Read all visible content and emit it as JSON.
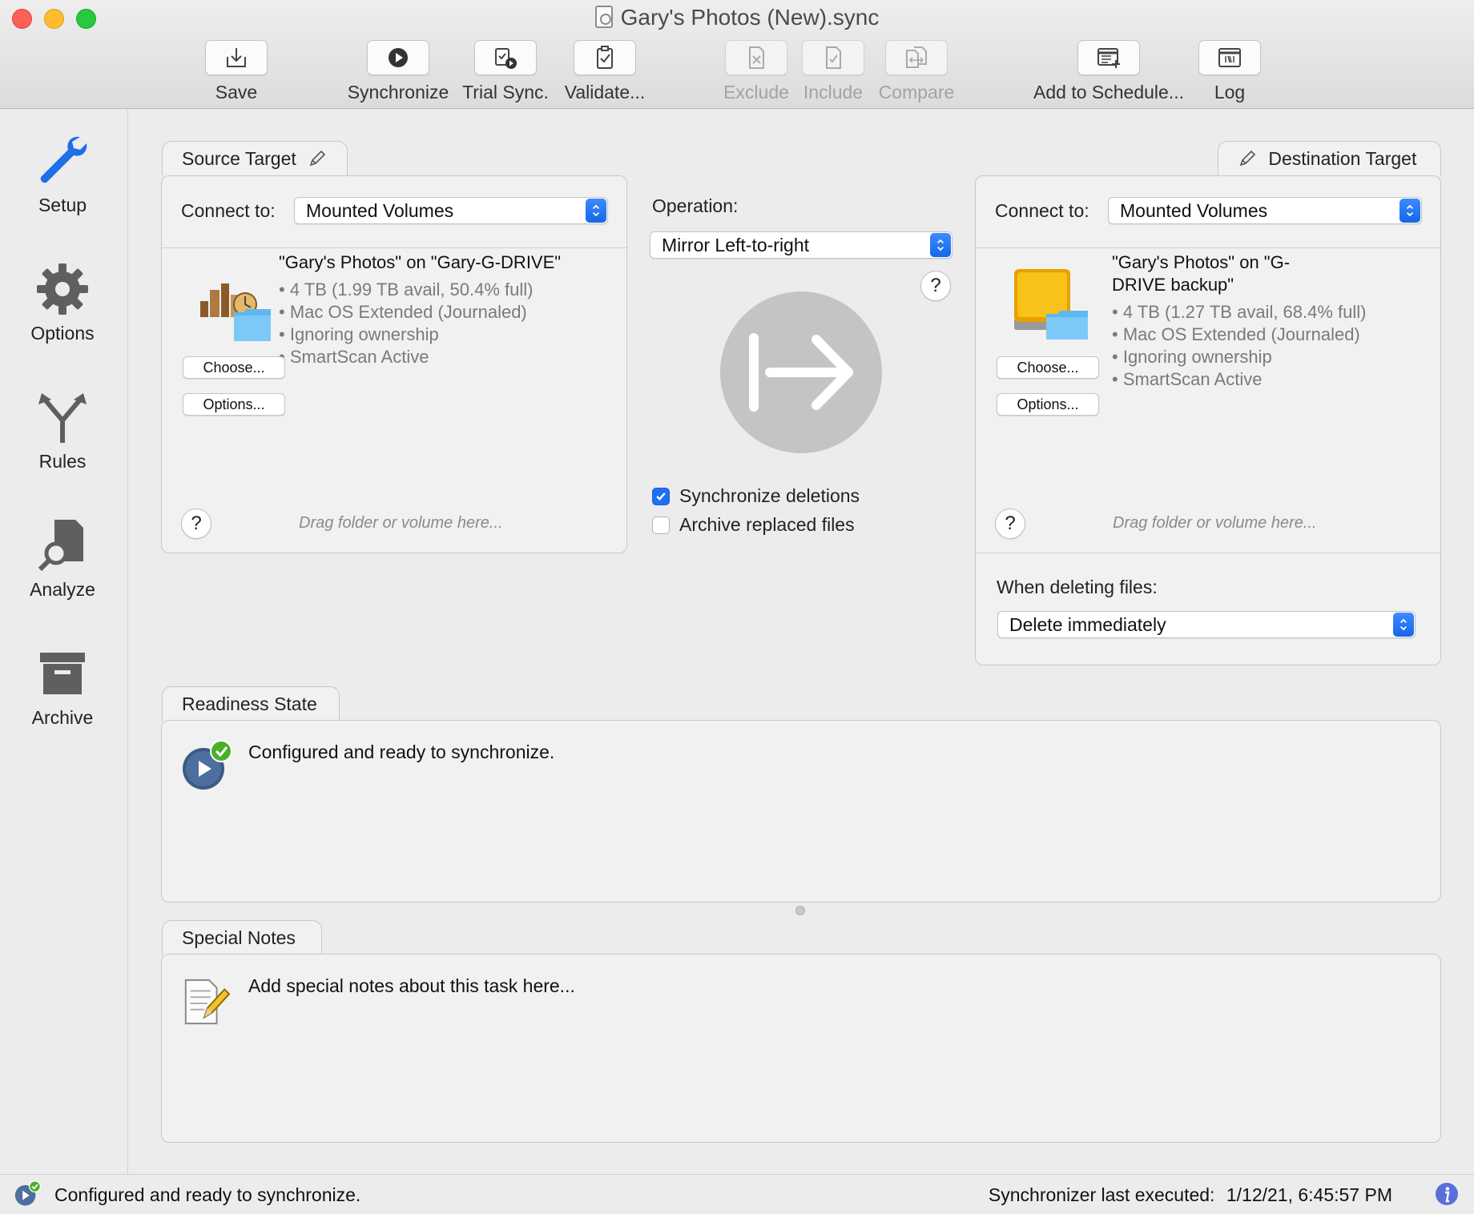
{
  "window": {
    "title": "Gary's Photos (New).sync"
  },
  "toolbar": {
    "save": "Save",
    "synchronize": "Synchronize",
    "trial_sync": "Trial Sync.",
    "validate": "Validate...",
    "exclude": "Exclude",
    "include": "Include",
    "compare": "Compare",
    "add_to_schedule": "Add to Schedule...",
    "log": "Log"
  },
  "sidebar": {
    "items": [
      {
        "label": "Setup",
        "icon": "wrench-icon"
      },
      {
        "label": "Options",
        "icon": "gear-icon"
      },
      {
        "label": "Rules",
        "icon": "fork-icon"
      },
      {
        "label": "Analyze",
        "icon": "magnifier-document-icon"
      },
      {
        "label": "Archive",
        "icon": "archive-box-icon"
      }
    ]
  },
  "source": {
    "tab": "Source Target",
    "connect_label": "Connect to:",
    "connect_value": "Mounted Volumes",
    "volume_name": "\"Gary's Photos\" on \"Gary-G-DRIVE\"",
    "details": [
      "4 TB (1.99 TB avail, 50.4% full)",
      "Mac OS Extended (Journaled)",
      "Ignoring ownership",
      "SmartScan Active"
    ],
    "choose": "Choose...",
    "options": "Options...",
    "help": "?",
    "drag_hint": "Drag folder or volume here..."
  },
  "operation": {
    "label": "Operation:",
    "value": "Mirror Left-to-right",
    "help": "?",
    "sync_deletions": {
      "label": "Synchronize deletions",
      "checked": true
    },
    "archive_replaced": {
      "label": "Archive replaced files",
      "checked": false
    }
  },
  "destination": {
    "tab": "Destination Target",
    "connect_label": "Connect to:",
    "connect_value": "Mounted Volumes",
    "volume_name_line1": "\"Gary's Photos\" on \"G-",
    "volume_name_line2": "DRIVE backup\"",
    "details": [
      "4 TB (1.27 TB avail, 68.4% full)",
      "Mac OS Extended (Journaled)",
      "Ignoring ownership",
      "SmartScan Active"
    ],
    "choose": "Choose...",
    "options": "Options...",
    "help": "?",
    "drag_hint": "Drag folder or volume here...",
    "deleting_label": "When deleting files:",
    "deleting_value": "Delete immediately"
  },
  "readiness": {
    "tab": "Readiness State",
    "message": "Configured and ready to synchronize."
  },
  "notes": {
    "tab": "Special Notes",
    "placeholder": "Add special notes about this task here..."
  },
  "statusbar": {
    "message": "Configured and ready to synchronize.",
    "last_executed_label": "Synchronizer last executed:",
    "last_executed_value": "1/12/21, 6:45:57 PM"
  },
  "colors": {
    "accent": "#1f6ff2",
    "close": "#fe5f57",
    "minimize": "#febc2e",
    "maximize": "#28c840",
    "ready_green": "#4caf2a"
  }
}
